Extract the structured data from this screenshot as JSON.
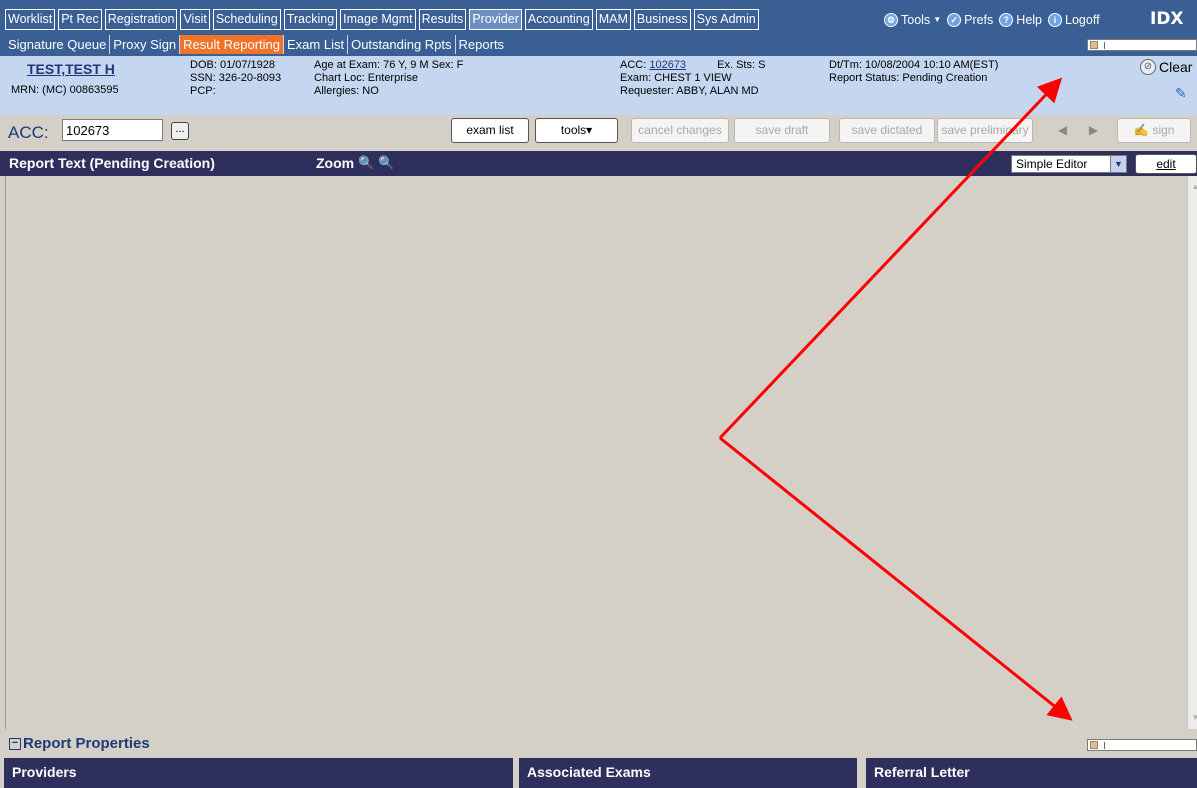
{
  "nav": {
    "tabs": [
      {
        "label": "Worklist"
      },
      {
        "label": "Pt Rec"
      },
      {
        "label": "Registration"
      },
      {
        "label": "Visit"
      },
      {
        "label": "Scheduling"
      },
      {
        "label": "Tracking"
      },
      {
        "label": "Image Mgmt"
      },
      {
        "label": "Results"
      },
      {
        "label": "Provider"
      },
      {
        "label": "Accounting"
      },
      {
        "label": "MAM"
      },
      {
        "label": "Business"
      },
      {
        "label": "Sys Admin"
      }
    ],
    "active_tab": "Provider",
    "links": {
      "tools": "Tools",
      "prefs": "Prefs",
      "help": "Help",
      "logoff": "Logoff"
    },
    "logo": "IDX"
  },
  "subnav": {
    "items": [
      {
        "label": "Signature Queue"
      },
      {
        "label": "Proxy Sign"
      },
      {
        "label": "Result Reporting"
      },
      {
        "label": "Exam List"
      },
      {
        "label": "Outstanding Rpts"
      },
      {
        "label": "Reports"
      }
    ],
    "active": "Result Reporting"
  },
  "patient": {
    "name": "TEST,TEST H",
    "mrn": "MRN: (MC) 00863595",
    "dob": "DOB: 01/07/1928",
    "ssn": "SSN: 326-20-8093",
    "pcp": "PCP:",
    "age": "Age at Exam: 76 Y, 9 M  Sex: F",
    "chart_loc": "Chart Loc: Enterprise",
    "allergies": "Allergies: NO",
    "acc_prefix": "ACC:",
    "acc": "102673",
    "ex_sts": "Ex. Sts: S",
    "exam": "Exam: CHEST 1 VIEW",
    "requester": "Requester: ABBY, ALAN MD",
    "dt_tm": "Dt/Tm: 10/08/2004 10:10 AM(EST)",
    "report_status": "Report Status: Pending Creation",
    "clear_label": "Clear"
  },
  "toolbar": {
    "acc_label": "ACC:",
    "acc_value": "102673",
    "dots": "...",
    "exam_list": "exam list",
    "tools": "tools▾",
    "cancel_changes": "cancel changes",
    "save_draft": "save draft",
    "save_dictated": "save dictated",
    "save_preliminary": "save preliminary",
    "sign": "sign"
  },
  "report": {
    "title": "Report Text (Pending Creation)",
    "zoom_label": "Zoom",
    "editor_select": "Simple Editor",
    "edit_button": "edit"
  },
  "properties": {
    "title": "Report Properties",
    "panels": [
      {
        "label": "Providers"
      },
      {
        "label": "Associated Exams"
      },
      {
        "label": "Referral Letter"
      }
    ]
  },
  "colors": {
    "nav_bg": "#3a5f95",
    "active_subnav": "#f0732a",
    "banner_bg": "#c5d6f0",
    "header_bg": "#2f2f5e",
    "annotation_arrow": "#ff0000"
  }
}
